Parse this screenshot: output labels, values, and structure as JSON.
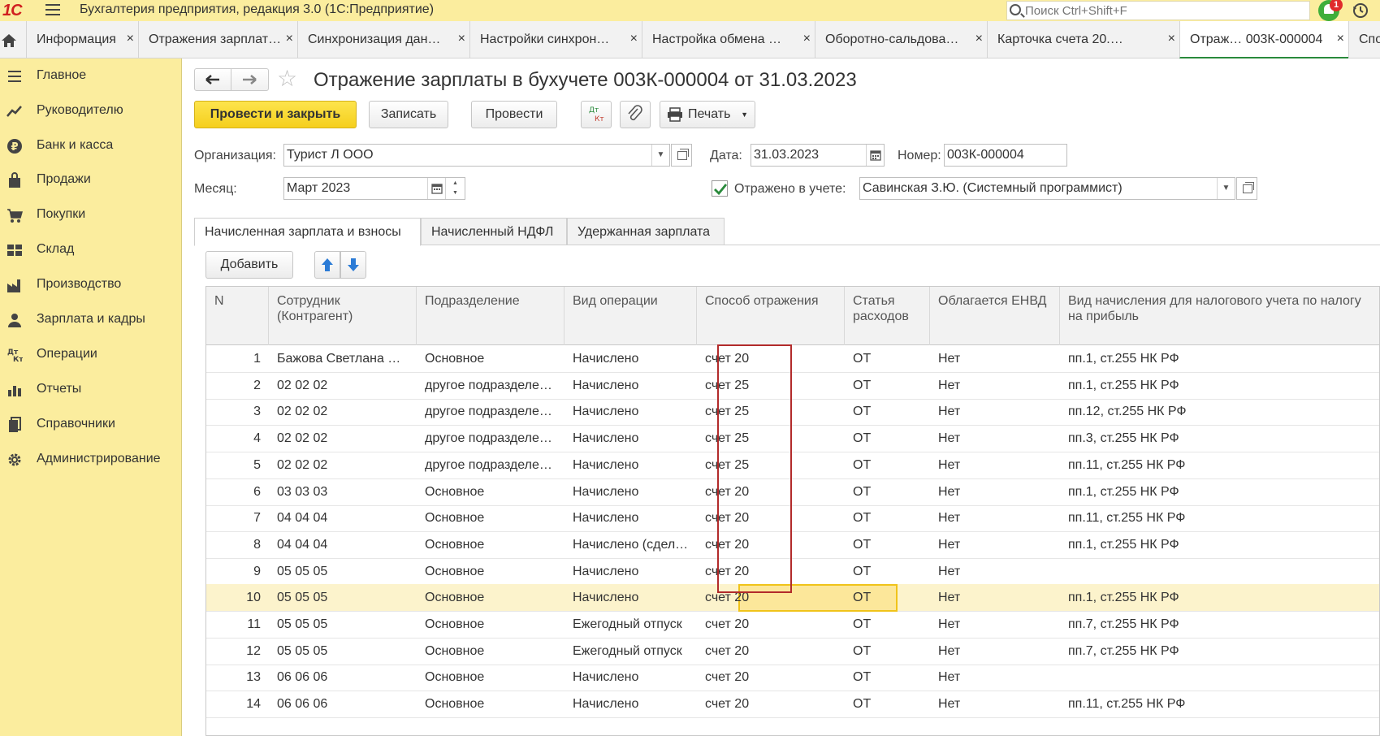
{
  "app": {
    "logo": "1С",
    "title": "Бухгалтерия предприятия, редакция 3.0  (1С:Предприятие)",
    "search_placeholder": "Поиск Ctrl+Shift+F",
    "notifications_count": "1"
  },
  "tabs": [
    {
      "label": "Информация",
      "close": "×"
    },
    {
      "label": "Отражения зарплат…",
      "close": "×"
    },
    {
      "label": "Синхронизация дан…",
      "close": "×"
    },
    {
      "label": "Настройки синхрон…",
      "close": "×"
    },
    {
      "label": "Настройка обмена …",
      "close": "×"
    },
    {
      "label": "Оборотно-сальдова…",
      "close": "×"
    },
    {
      "label": "Карточка счета 20.…",
      "close": "×"
    },
    {
      "label": "Отраж… 003К-000004",
      "close": "×"
    },
    {
      "label": "Спо",
      "close": ""
    }
  ],
  "sidebar": {
    "items": [
      {
        "label": "Главное",
        "icon": "menu-icon"
      },
      {
        "label": "Руководителю",
        "icon": "trend-icon"
      },
      {
        "label": "Банк и касса",
        "icon": "ruble-icon"
      },
      {
        "label": "Продажи",
        "icon": "bag-icon"
      },
      {
        "label": "Покупки",
        "icon": "cart-icon"
      },
      {
        "label": "Склад",
        "icon": "warehouse-icon"
      },
      {
        "label": "Производство",
        "icon": "factory-icon"
      },
      {
        "label": "Зарплата и кадры",
        "icon": "person-icon"
      },
      {
        "label": "Операции",
        "icon": "dt-kt-icon"
      },
      {
        "label": "Отчеты",
        "icon": "bar-chart-icon"
      },
      {
        "label": "Справочники",
        "icon": "books-icon"
      },
      {
        "label": "Администрирование",
        "icon": "gear-icon"
      }
    ]
  },
  "document": {
    "title": "Отражение зарплаты в бухучете 003К-000004 от 31.03.2023",
    "toolbar": {
      "post_close": "Провести и закрыть",
      "save": "Записать",
      "post": "Провести",
      "dtkt": "Дт Кт",
      "print": "Печать"
    },
    "fields": {
      "org_label": "Организация:",
      "org_value": "Турист Л ООО",
      "date_label": "Дата:",
      "date_value": "31.03.2023",
      "number_label": "Номер:",
      "number_value": "003К-000004",
      "month_label": "Месяц:",
      "month_value": "Март 2023",
      "reflected_label": "Отражено в учете:",
      "reflected_checked": true,
      "responsible_value": "Савинская З.Ю. (Системный программист)"
    },
    "form_tabs": [
      "Начисленная зарплата и взносы",
      "Начисленный НДФЛ",
      "Удержанная зарплата"
    ],
    "add_button": "Добавить",
    "table": {
      "columns": [
        "N",
        "Сотрудник (Контрагент)",
        "Подразделение",
        "Вид операции",
        "Способ отражения",
        "Статья расходов",
        "Облагается ЕНВД",
        "Вид начисления для налогового учета по налогу на прибыль"
      ],
      "rows": [
        [
          "1",
          "Бажова Светлана Н…",
          "Основное",
          "Начислено",
          "счет 20",
          "ОТ",
          "Нет",
          "пп.1, ст.255 НК РФ"
        ],
        [
          "2",
          "02 02 02",
          "другое подразделен…",
          "Начислено",
          "счет 25",
          "ОТ",
          "Нет",
          "пп.1, ст.255 НК РФ"
        ],
        [
          "3",
          "02 02 02",
          "другое подразделен…",
          "Начислено",
          "счет 25",
          "ОТ",
          "Нет",
          "пп.12, ст.255 НК РФ"
        ],
        [
          "4",
          "02 02 02",
          "другое подразделен…",
          "Начислено",
          "счет 25",
          "ОТ",
          "Нет",
          "пп.3, ст.255 НК РФ"
        ],
        [
          "5",
          "02 02 02",
          "другое подразделен…",
          "Начислено",
          "счет 25",
          "ОТ",
          "Нет",
          "пп.11, ст.255 НК РФ"
        ],
        [
          "6",
          "03 03 03",
          "Основное",
          "Начислено",
          "счет 20",
          "ОТ",
          "Нет",
          "пп.1, ст.255 НК РФ"
        ],
        [
          "7",
          "04 04 04",
          "Основное",
          "Начислено",
          "счет 20",
          "ОТ",
          "Нет",
          "пп.11, ст.255 НК РФ"
        ],
        [
          "8",
          "04 04 04",
          "Основное",
          "Начислено (сдел…",
          "счет 20",
          "ОТ",
          "Нет",
          "пп.1, ст.255 НК РФ"
        ],
        [
          "9",
          "05 05 05",
          "Основное",
          "Начислено",
          "счет 20",
          "ОТ",
          "Нет",
          ""
        ],
        [
          "10",
          "05 05 05",
          "Основное",
          "Начислено",
          "счет 20",
          "ОТ",
          "Нет",
          "пп.1, ст.255 НК РФ"
        ],
        [
          "11",
          "05 05 05",
          "Основное",
          "Ежегодный отпуск",
          "счет 20",
          "ОТ",
          "Нет",
          "пп.7, ст.255 НК РФ"
        ],
        [
          "12",
          "05 05 05",
          "Основное",
          "Ежегодный отпуск",
          "счет 20",
          "ОТ",
          "Нет",
          "пп.7, ст.255 НК РФ"
        ],
        [
          "13",
          "06 06 06",
          "Основное",
          "Начислено",
          "счет 20",
          "ОТ",
          "Нет",
          ""
        ],
        [
          "14",
          "06 06 06",
          "Основное",
          "Начислено",
          "счет 20",
          "ОТ",
          "Нет",
          "пп.11, ст.255 НК РФ"
        ]
      ],
      "selected_row": 10
    }
  },
  "colors": {
    "sidebar_bg": "#fbed9e",
    "primary_button": "#f5cf1d",
    "highlight_border": "#b22b2b",
    "selected_row": "#fcf3cc"
  }
}
